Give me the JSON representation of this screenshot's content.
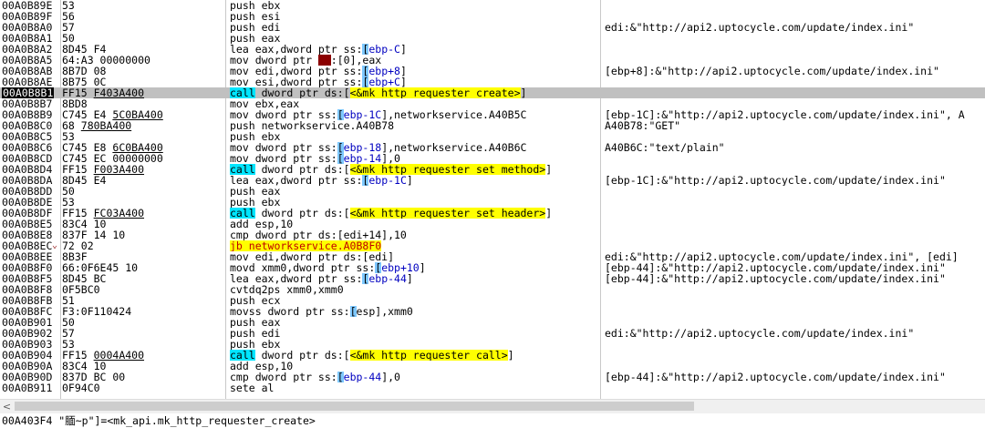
{
  "rows": [
    {
      "addr": "00A0B89E",
      "bytes": "53",
      "instr": "push ebx",
      "comment": ""
    },
    {
      "addr": "00A0B89F",
      "bytes": "56",
      "instr": "push esi",
      "comment": ""
    },
    {
      "addr": "00A0B8A0",
      "bytes": "57",
      "instr": "push edi",
      "comment": "edi:&\"http://api2.uptocycle.com/update/index.ini\""
    },
    {
      "addr": "00A0B8A1",
      "bytes": "50",
      "instr": "push eax",
      "comment": ""
    },
    {
      "addr": "00A0B8A2",
      "bytes": "8D45 F4",
      "instr": "lea eax,dword ptr ss:[ebp-C]",
      "comment": ""
    },
    {
      "addr": "00A0B8A5",
      "bytes": "64:A3 00000000",
      "instr": "mov dword ptr fs:[0],eax",
      "comment": ""
    },
    {
      "addr": "00A0B8AB",
      "bytes": "8B7D 08",
      "instr": "mov edi,dword ptr ss:[ebp+8]",
      "comment": "[ebp+8]:&\"http://api2.uptocycle.com/update/index.ini\""
    },
    {
      "addr": "00A0B8AE",
      "bytes": "8B75 0C",
      "instr": "mov esi,dword ptr ss:[ebp+C]",
      "comment": ""
    },
    {
      "addr": "00A0B8B1",
      "bytes": "FF15 F403A400",
      "instr": "call dword ptr ds:[<&mk_http_requester_create>]",
      "comment": ""
    },
    {
      "addr": "00A0B8B7",
      "bytes": "8BD8",
      "instr": "mov ebx,eax",
      "comment": ""
    },
    {
      "addr": "00A0B8B9",
      "bytes": "C745 E4 5C0BA400",
      "instr": "mov dword ptr ss:[ebp-1C],networkservice.A40B5C",
      "comment": "[ebp-1C]:&\"http://api2.uptocycle.com/update/index.ini\", A"
    },
    {
      "addr": "00A0B8C0",
      "bytes": "68 780BA400",
      "instr": "push networkservice.A40B78",
      "comment": "A40B78:\"GET\""
    },
    {
      "addr": "00A0B8C5",
      "bytes": "53",
      "instr": "push ebx",
      "comment": ""
    },
    {
      "addr": "00A0B8C6",
      "bytes": "C745 E8 6C0BA400",
      "instr": "mov dword ptr ss:[ebp-18],networkservice.A40B6C",
      "comment": "A40B6C:\"text/plain\""
    },
    {
      "addr": "00A0B8CD",
      "bytes": "C745 EC 00000000",
      "instr": "mov dword ptr ss:[ebp-14],0",
      "comment": ""
    },
    {
      "addr": "00A0B8D4",
      "bytes": "FF15 F003A400",
      "instr": "call dword ptr ds:[<&mk_http_requester_set_method>]",
      "comment": ""
    },
    {
      "addr": "00A0B8DA",
      "bytes": "8D45 E4",
      "instr": "lea eax,dword ptr ss:[ebp-1C]",
      "comment": "[ebp-1C]:&\"http://api2.uptocycle.com/update/index.ini\""
    },
    {
      "addr": "00A0B8DD",
      "bytes": "50",
      "instr": "push eax",
      "comment": ""
    },
    {
      "addr": "00A0B8DE",
      "bytes": "53",
      "instr": "push ebx",
      "comment": ""
    },
    {
      "addr": "00A0B8DF",
      "bytes": "FF15 FC03A400",
      "instr": "call dword ptr ds:[<&mk_http_requester_set_header>]",
      "comment": ""
    },
    {
      "addr": "00A0B8E5",
      "bytes": "83C4 10",
      "instr": "add esp,10",
      "comment": ""
    },
    {
      "addr": "00A0B8E8",
      "bytes": "837F 14 10",
      "instr": "cmp dword ptr ds:[edi+14],10",
      "comment": ""
    },
    {
      "addr": "00A0B8EC",
      "bytes": "72 02",
      "instr": "jb networkservice.A0B8F0",
      "comment": ""
    },
    {
      "addr": "00A0B8EE",
      "bytes": "8B3F",
      "instr": "mov edi,dword ptr ds:[edi]",
      "comment": "edi:&\"http://api2.uptocycle.com/update/index.ini\", [edi]"
    },
    {
      "addr": "00A0B8F0",
      "bytes": "66:0F6E45 10",
      "instr": "movd xmm0,dword ptr ss:[ebp+10]",
      "comment": "[ebp-44]:&\"http://api2.uptocycle.com/update/index.ini\""
    },
    {
      "addr": "00A0B8F5",
      "bytes": "8D45 BC",
      "instr": "lea eax,dword ptr ss:[ebp-44]",
      "comment": "[ebp-44]:&\"http://api2.uptocycle.com/update/index.ini\""
    },
    {
      "addr": "00A0B8F8",
      "bytes": "0F5BC0",
      "instr": "cvtdq2ps xmm0,xmm0",
      "comment": ""
    },
    {
      "addr": "00A0B8FB",
      "bytes": "51",
      "instr": "push ecx",
      "comment": ""
    },
    {
      "addr": "00A0B8FC",
      "bytes": "F3:0F110424",
      "instr": "movss dword ptr ss:[esp],xmm0",
      "comment": ""
    },
    {
      "addr": "00A0B901",
      "bytes": "50",
      "instr": "push eax",
      "comment": ""
    },
    {
      "addr": "00A0B902",
      "bytes": "57",
      "instr": "push edi",
      "comment": "edi:&\"http://api2.uptocycle.com/update/index.ini\""
    },
    {
      "addr": "00A0B903",
      "bytes": "53",
      "instr": "push ebx",
      "comment": ""
    },
    {
      "addr": "00A0B904",
      "bytes": "FF15 0004A400",
      "instr": "call dword ptr ds:[<&mk_http_requester_call>]",
      "comment": ""
    },
    {
      "addr": "00A0B90A",
      "bytes": "83C4 10",
      "instr": "add esp,10",
      "comment": ""
    },
    {
      "addr": "00A0B90D",
      "bytes": "837D BC 00",
      "instr": "cmp dword ptr ss:[ebp-44],0",
      "comment": "[ebp-44]:&\"http://api2.uptocycle.com/update/index.ini\""
    },
    {
      "addr": "00A0B911",
      "bytes": "0F94C0",
      "instr": "sete al",
      "comment": ""
    }
  ],
  "selected_addr": "00A0B8B1",
  "branch_arrow": "⌄",
  "scroll_left": "<",
  "status_text": "00A403F4 \"腼~p\"]=<mk_api.mk_http_requester_create>"
}
